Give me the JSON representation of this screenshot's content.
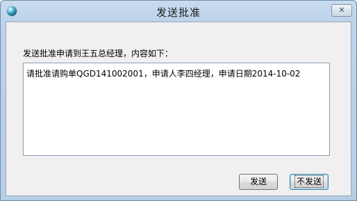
{
  "window": {
    "title": "发送批准",
    "close_glyph": "✕"
  },
  "dialog": {
    "prompt": "发送批准申请到王五总经理，内容如下：",
    "content": "请批准请购单QGD141002001，申请人李四经理，申请日期2014-10-02"
  },
  "buttons": {
    "send_label": "发送",
    "no_send_label": "不发送"
  },
  "icons": {
    "app": "globe-icon",
    "close": "close-icon"
  }
}
